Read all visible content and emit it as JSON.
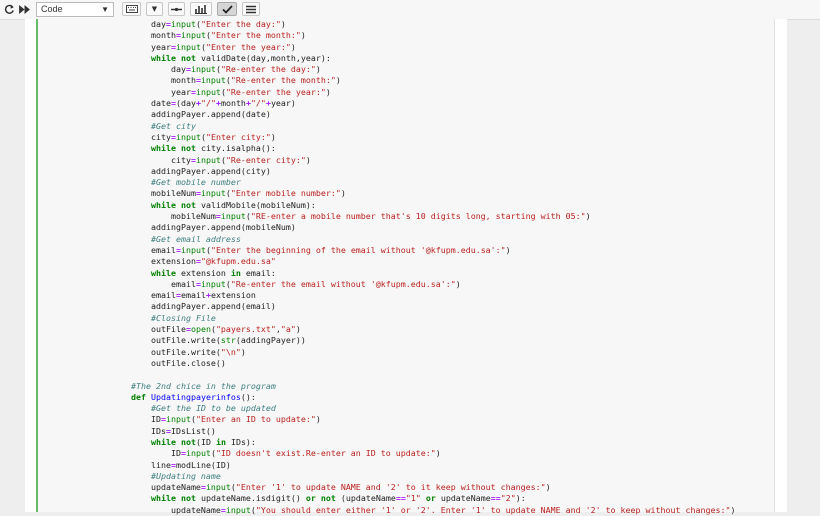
{
  "toolbar": {
    "run_icon": "refresh-icon",
    "fast_forward_icon": "fast-forward-icon",
    "cell_type": "Code",
    "buttons": [
      "keyboard-icon",
      "dropdown-icon",
      "separator-icon",
      "chart-icon",
      "check-icon",
      "list-icon"
    ],
    "active_button": "check-icon"
  },
  "colors": {
    "cell_border": "#66bb6a",
    "keyword": "#008000",
    "string": "#ba2121",
    "comment": "#408080",
    "function_name": "#0000ff"
  },
  "code_lines": [
    "    day=input(\"Enter the day:\")",
    "    month=input(\"Enter the month:\")",
    "    year=input(\"Enter the year:\")",
    "    while not validDate(day,month,year):",
    "        day=input(\"Re-enter the day:\")",
    "        month=input(\"Re-enter the month:\")",
    "        year=input(\"Re-enter the year:\")",
    "    date=(day+\"/\"+month+\"/\"+year)",
    "    addingPayer.append(date)",
    "    #Get city",
    "    city=input(\"Enter city:\")",
    "    while not city.isalpha():",
    "        city=input(\"Re-enter city:\")",
    "    addingPayer.append(city)",
    "    #Get mobile number",
    "    mobileNum=input(\"Enter mobile number:\")",
    "    while not validMobile(mobileNum):",
    "        mobileNum=input(\"RE-enter a mobile number that's 10 digits long, starting with 05:\")",
    "    addingPayer.append(mobileNum)",
    "    #Get email address",
    "    email=input(\"Enter the beginning of the email without '@kfupm.edu.sa':\")",
    "    extension=\"@kfupm.edu.sa\"",
    "    while extension in email:",
    "        email=input(\"Re-enter the email without '@kfupm.edu.sa':\")",
    "    email=email+extension",
    "    addingPayer.append(email)",
    "    #Closing File",
    "    outFile=open(\"payers.txt\",\"a\")",
    "    outFile.write(str(addingPayer))",
    "    outFile.write(\"\\n\")",
    "    outFile.close()",
    "",
    "#The 2nd chice in the program",
    "def Updatingpayerinfos():",
    "    #Get the ID to be updated",
    "    ID=input(\"Enter an ID to update:\")",
    "    IDs=IDsList()",
    "    while not(ID in IDs):",
    "        ID=input(\"ID doesn't exist.Re-enter an ID to update:\")",
    "    line=modLine(ID)",
    "    #Updating name",
    "    updateName=input(\"Enter '1' to update NAME and '2' to it keep without changes:\")",
    "    while not updateName.isdigit() or not (updateName==\"1\" or updateName==\"2\"):",
    "        updateName=input(\"You should enter either '1' or '2'. Enter '1' to update NAME and '2' to keep without changes:\")"
  ]
}
